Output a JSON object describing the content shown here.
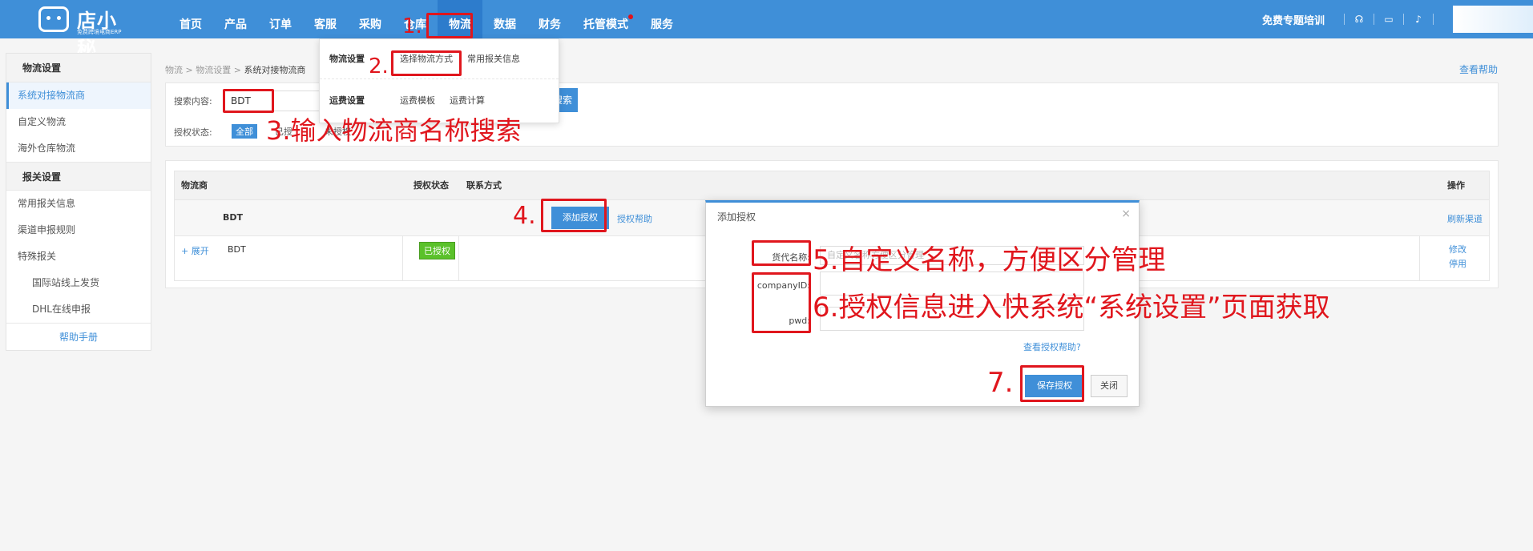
{
  "topbar": {
    "logo_name": "店小秘",
    "logo_sub": "免费跨境电商ERP",
    "nav": [
      "首页",
      "产品",
      "订单",
      "客服",
      "采购",
      "仓库",
      "物流",
      "数据",
      "财务",
      "托管模式",
      "服务"
    ],
    "active_nav": "物流",
    "training": "免费专题培训"
  },
  "breadcrumb": {
    "root": "物流",
    "mid": "物流设置",
    "current": "系统对接物流商",
    "sep": ">"
  },
  "view_help": "查看帮助",
  "sidebar": {
    "group1": "物流设置",
    "items1": [
      "系统对接物流商",
      "自定义物流",
      "海外仓库物流"
    ],
    "group2": "报关设置",
    "items2": [
      "常用报关信息",
      "渠道申报规则",
      "特殊报关"
    ],
    "sub_items": [
      "国际站线上发货",
      "DHL在线申报"
    ],
    "help": "帮助手册"
  },
  "search": {
    "label": "搜索内容:",
    "value": "BDT",
    "button": "搜索",
    "status_label": "授权状态:",
    "status_all": "全部",
    "status_partial_1": "已授",
    "status_partial_2": "未授权"
  },
  "dropdown": {
    "row1_head": "物流设置",
    "row1_items": [
      "选择物流方式",
      "常用报关信息"
    ],
    "row2_head": "运费设置",
    "row2_items": [
      "运费模板",
      "运费计算"
    ]
  },
  "table": {
    "headers": {
      "carrier": "物流商",
      "status": "授权状态",
      "contact": "联系方式",
      "action": "操作"
    },
    "group": {
      "name": "BDT",
      "add_auth": "添加授权",
      "auth_help": "授权帮助",
      "refresh": "刷新渠道"
    },
    "row": {
      "expand": "+ 展开",
      "name": "BDT",
      "status": "已授权",
      "edit": "修改",
      "disable": "停用"
    }
  },
  "modal": {
    "title": "添加授权",
    "close": "×",
    "alias_label": "货代名称:",
    "alias_placeholder": "自定义名称方便区分管理",
    "company_label": "companyID:",
    "pwd_label": "pwd:",
    "help_link": "查看授权帮助?",
    "save": "保存授权",
    "cancel": "关闭"
  },
  "annotations": {
    "a1": "1.",
    "a2": "2.",
    "a3": "3.输入物流商名称搜索",
    "a4": "4.",
    "a5": "5.自定义名称，方便区分管理",
    "a6": "6.授权信息进入快系统“系统设置”页面获取",
    "a7": "7."
  },
  "colors": {
    "brand": "#3f8fd8",
    "annotation_red": "#e0161d",
    "authorized_green": "#5ac12a"
  }
}
